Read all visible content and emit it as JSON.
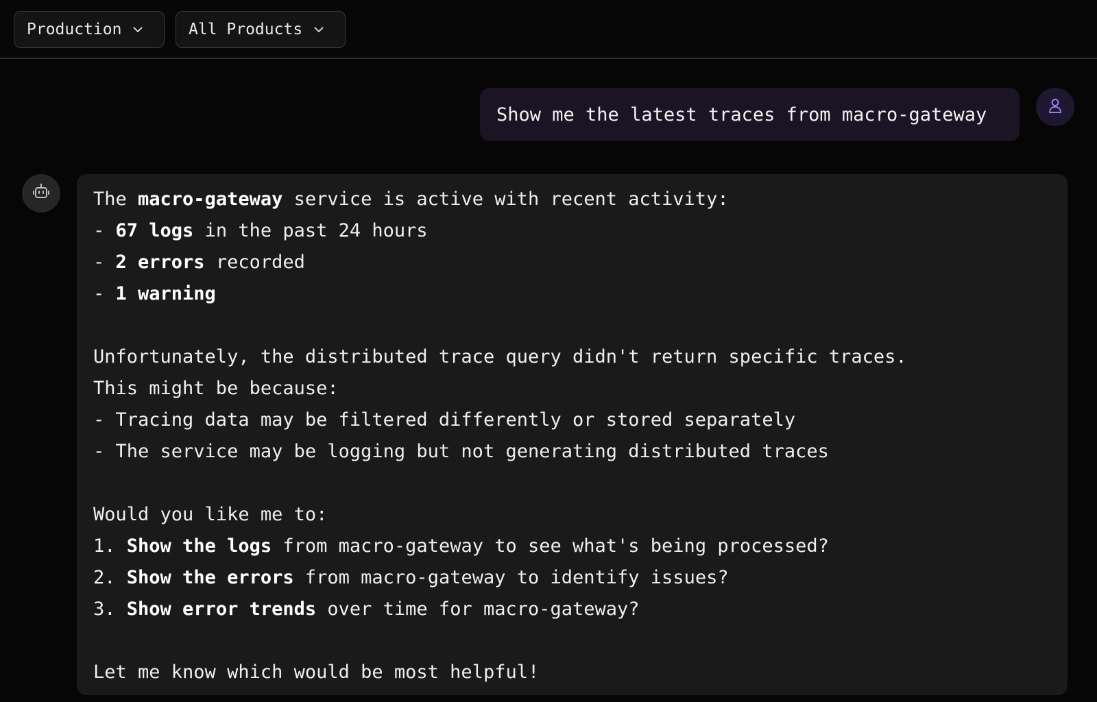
{
  "toolbar": {
    "environment": "Production",
    "products": "All Products"
  },
  "user_message": "Show me the latest traces from macro-gateway",
  "assistant_message": {
    "intro": {
      "a": "The ",
      "b": "macro-gateway",
      "c": " service is active with recent activity:"
    },
    "stats": [
      {
        "prefix": "- ",
        "bold": "67 logs",
        "rest": " in the past 24 hours"
      },
      {
        "prefix": "- ",
        "bold": "2 errors",
        "rest": " recorded"
      },
      {
        "prefix": "- ",
        "bold": "1 warning",
        "rest": ""
      }
    ],
    "para2_line1": "Unfortunately, the distributed trace query didn't return specific traces.",
    "para2_line2": "This might be because:",
    "reasons": [
      "- Tracing data may be filtered differently or stored separately",
      "- The service may be logging but not generating distributed traces"
    ],
    "question": "Would you like me to:",
    "options": [
      {
        "prefix": "1. ",
        "bold": "Show the logs",
        "rest": " from macro-gateway to see what's being processed?"
      },
      {
        "prefix": "2. ",
        "bold": "Show the errors",
        "rest": " from macro-gateway to identify issues?"
      },
      {
        "prefix": "3. ",
        "bold": "Show error trends",
        "rest": " over time for macro-gateway?"
      }
    ],
    "closing": "Let me know which would be most helpful!"
  },
  "icons": {
    "dropdown": "chevron-down-icon",
    "user": "user-icon",
    "assistant": "robot-icon"
  },
  "colors": {
    "accent": "#9b7cf0",
    "user_bubble": "#1a1424",
    "assistant_bubble": "#1a1a1a"
  }
}
